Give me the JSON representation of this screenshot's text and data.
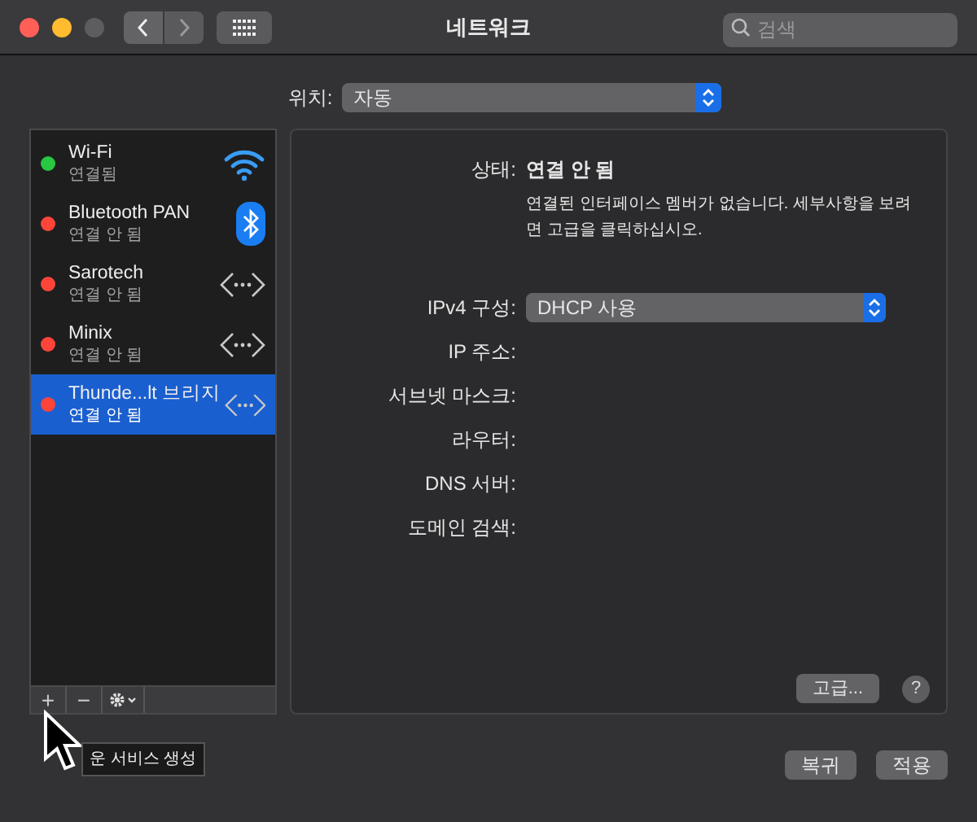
{
  "window": {
    "title": "네트워크",
    "search": {
      "placeholder": "검색"
    }
  },
  "location": {
    "label": "위치:",
    "value": "자동"
  },
  "services": [
    {
      "name": "Wi-Fi",
      "status": "연결됨",
      "color": "#28c840",
      "kind": "wifi",
      "selected": false
    },
    {
      "name": "Bluetooth PAN",
      "status": "연결 안 됨",
      "color": "#ff453a",
      "kind": "bluetooth",
      "selected": false
    },
    {
      "name": "Sarotech",
      "status": "연결 안 됨",
      "color": "#ff453a",
      "kind": "ethernet",
      "selected": false
    },
    {
      "name": "Minix",
      "status": "연결 안 됨",
      "color": "#ff453a",
      "kind": "ethernet",
      "selected": false
    },
    {
      "name": "Thunde...lt 브리지",
      "status": "연결 안 됨",
      "color": "#ff453a",
      "kind": "ethernet",
      "selected": true
    }
  ],
  "list_toolbar": {
    "add": "+",
    "remove": "−"
  },
  "tooltip": "운 서비스 생성",
  "detail": {
    "status_label": "상태:",
    "status_value": "연결 안 됨",
    "description": "연결된 인터페이스 멤버가 없습니다. 세부사항을 보려면 고급을 클릭하십시오.",
    "fields": [
      {
        "label": "IPv4 구성:",
        "kind": "select",
        "value": "DHCP 사용"
      },
      {
        "label": "IP 주소:",
        "kind": "value"
      },
      {
        "label": "서브넷 마스크:",
        "kind": "value"
      },
      {
        "label": "라우터:",
        "kind": "value"
      },
      {
        "label": "DNS 서버:",
        "kind": "value"
      },
      {
        "label": "도메인 검색:",
        "kind": "value"
      }
    ],
    "advanced_button": "고급...",
    "help": "?"
  },
  "footer_buttons": [
    "복귀",
    "적용"
  ]
}
